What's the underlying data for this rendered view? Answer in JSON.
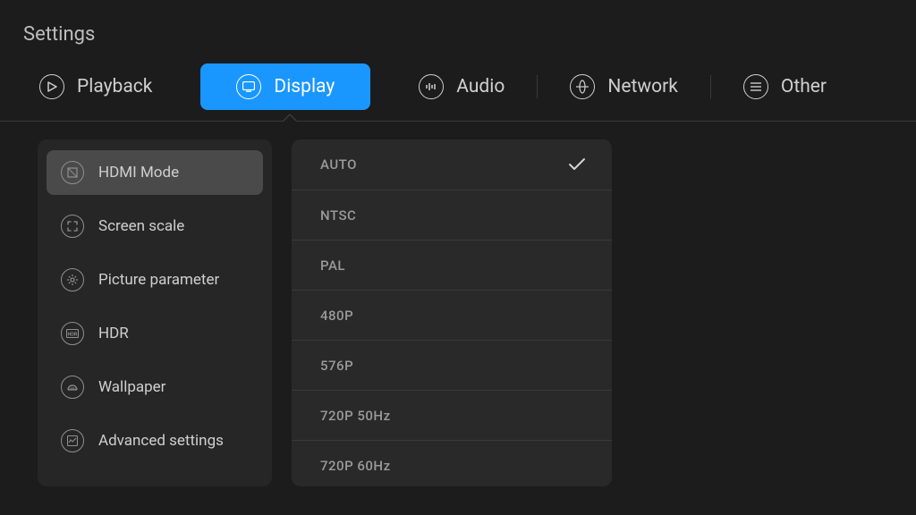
{
  "page_title": "Settings",
  "tabs": [
    {
      "id": "playback",
      "label": "Playback"
    },
    {
      "id": "display",
      "label": "Display"
    },
    {
      "id": "audio",
      "label": "Audio"
    },
    {
      "id": "network",
      "label": "Network"
    },
    {
      "id": "other",
      "label": "Other"
    }
  ],
  "active_tab": "display",
  "sidebar": {
    "items": [
      {
        "id": "hdmi-mode",
        "label": "HDMI Mode"
      },
      {
        "id": "screen-scale",
        "label": "Screen scale"
      },
      {
        "id": "picture-param",
        "label": "Picture parameter"
      },
      {
        "id": "hdr",
        "label": "HDR"
      },
      {
        "id": "wallpaper",
        "label": "Wallpaper"
      },
      {
        "id": "advanced",
        "label": "Advanced settings"
      }
    ],
    "selected": "hdmi-mode"
  },
  "options": {
    "items": [
      {
        "id": "auto",
        "label": "AUTO"
      },
      {
        "id": "ntsc",
        "label": "NTSC"
      },
      {
        "id": "pal",
        "label": "PAL"
      },
      {
        "id": "480p",
        "label": "480P"
      },
      {
        "id": "576p",
        "label": "576P"
      },
      {
        "id": "720p50",
        "label": "720P  50Hz"
      },
      {
        "id": "720p60",
        "label": "720P  60Hz"
      }
    ],
    "selected": "auto"
  }
}
